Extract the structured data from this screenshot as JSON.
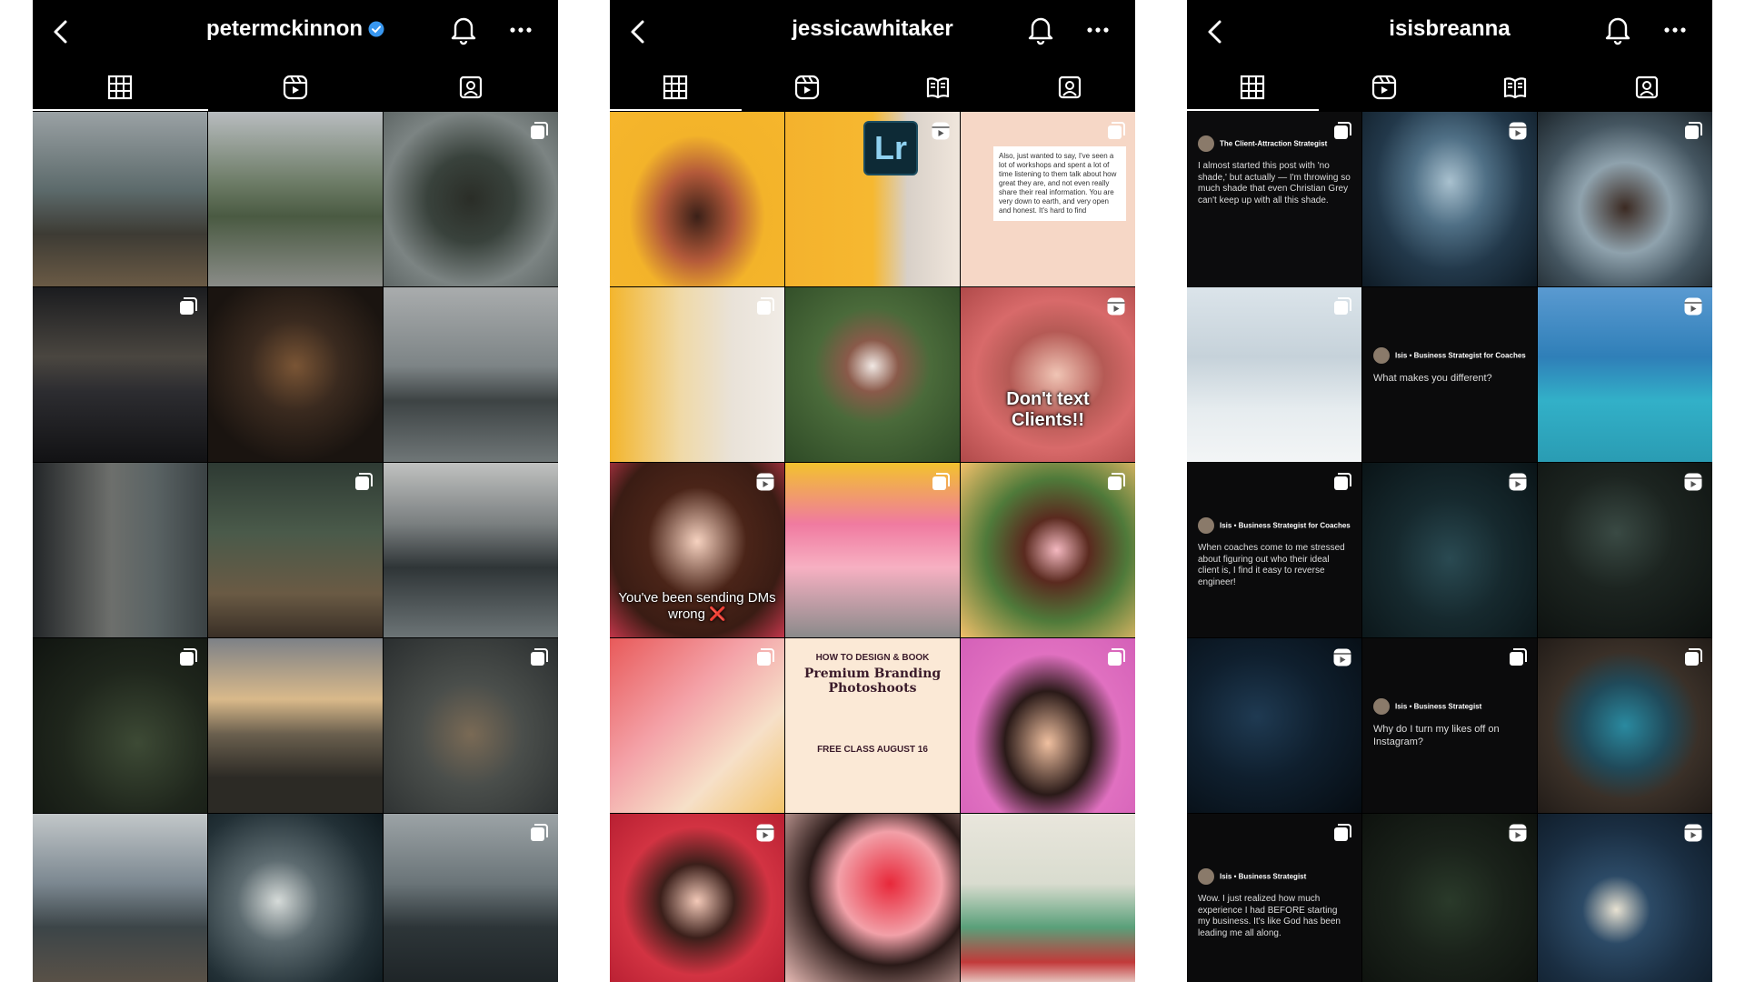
{
  "panels": [
    {
      "username": "petermckinnon",
      "verified": true,
      "tabs": [
        "grid-icon",
        "reels-icon",
        "tagged-icon"
      ],
      "tiles": [
        {
          "bg": "linear-gradient(180deg,#9aa1a4 0%,#5c6a6b 45%,#3d3b34 70%,#6a5a45 100%)"
        },
        {
          "bg": "linear-gradient(180deg,#b8bcbf 0%,#6e7d68 40%,#4a5a42 60%,#8a8c88 100%)"
        },
        {
          "bg": "radial-gradient(circle at 50% 50%,#2a2d27 0%,#39423c 35%,#7c8483 70%,#5f6766 100%)",
          "badge": "carousel-icon"
        },
        {
          "bg": "linear-gradient(180deg,#1b1c1f 0%,#4a4640 40%,#2c2c30 60%,#121214 100%)",
          "badge": "carousel-icon"
        },
        {
          "bg": "radial-gradient(circle at 50% 45%,#7a5535 0%,#3a2a1f 35%,#1a1410 75%)"
        },
        {
          "bg": "linear-gradient(180deg,#a9acad 0%,#7d8486 45%,#3d4344 65%,#6f7677 100%)"
        },
        {
          "bg": "linear-gradient(90deg,#232628 0%,#6d6f6c 45%,#5a6364 70%,#3b4244 100%)"
        },
        {
          "bg": "linear-gradient(180deg,#2e3a33 0%,#4a5a4a 40%,#6a5a44 75%,#3a2f26 100%)",
          "badge": "carousel-icon"
        },
        {
          "bg": "linear-gradient(180deg,#c0c1c0 0%,#7a7f80 35%,#2f3537 60%,#6c7476 100%)"
        },
        {
          "bg": "radial-gradient(circle at 60% 60%,#3d4a35 0%,#1f261c 50%,#101410 100%)",
          "badge": "carousel-icon"
        },
        {
          "bg": "linear-gradient(180deg,#7d8187 0%,#d9b98a 35%,#6a5f4e 55%,#2c2a25 80%)"
        },
        {
          "bg": "radial-gradient(circle at 50% 55%,#7a6a55 0%,#4a4e4b 40%,#2a2e2f 100%)",
          "badge": "carousel-icon"
        },
        {
          "bg": "linear-gradient(180deg,#c2c7c9 0%,#7b8790 40%,#3c4548 65%,#5c5247 100%)"
        },
        {
          "bg": "radial-gradient(circle at 40% 50%,#d6dbd9 0%,#5d6b70 30%,#223036 70%,#0f1a1f 100%)"
        },
        {
          "bg": "linear-gradient(180deg,#9ca3a6 0%,#6a7478 40%,#2d3538 65%,#1d2326 100%)",
          "badge": "carousel-icon"
        }
      ]
    },
    {
      "username": "jessicawhitaker",
      "verified": false,
      "tabs": [
        "grid-icon",
        "reels-icon",
        "guides-icon",
        "tagged-icon"
      ],
      "tiles": [
        {
          "bg": "radial-gradient(ellipse at 50% 60%,#3a2018 0%,#b45a3a 30%,#f3b32a 55%,#f6b62c 100%)"
        },
        {
          "bg": "linear-gradient(90deg,#f4b22d 0%,#f6b830 50%,#d8d0c8 70%,#f0e6dc 100%)",
          "badge": "reels-icon",
          "lr": "Lr"
        },
        {
          "bg": "#f6d7c6",
          "badge": "carousel-icon",
          "note": "Also, just wanted to say, I've seen a lot of workshops and spent a lot of time listening to them talk about how great they are, and not even really share their real information. You are very down to earth, and very open and honest. It's hard to find"
        },
        {
          "bg": "linear-gradient(90deg,#f3b52c 0%,#f0d9a6 40%,#e9e2d8 70%,#f1ece6 100%)",
          "badge": "carousel-icon"
        },
        {
          "bg": "radial-gradient(circle at 50% 45%,#f1e8e4 0%,#8a5a4a 20%,#4a6a3a 45%,#2e4a26 100%)"
        },
        {
          "bg": "radial-gradient(ellipse at 55% 50%,#f0c5b5 0%,#b55a55 35%,#d86a6a 60%,#b04a4a 100%)",
          "badge": "reels-icon",
          "caption": "Don't text Clients!!"
        },
        {
          "bg": "radial-gradient(ellipse at 50% 45%,#f6d2c0 0%,#4a2418 40%,#3a1c14 70%,#c2364a 100%)",
          "badge": "reels-icon",
          "caption": "You've been sending DMs wrong ❌"
        },
        {
          "bg": "linear-gradient(180deg,#f2c22e 0%,#f07aa0 35%,#f7b0c2 60%,#8a8a8a 100%)",
          "badge": "carousel-icon"
        },
        {
          "bg": "radial-gradient(circle at 55% 50%,#f4b8c0 0%,#5a2a1f 25%,#4f7a3a 55%,#f2c06a 100%)",
          "badge": "carousel-icon"
        },
        {
          "bg": "linear-gradient(135deg,#e85a5a 0%,#f4a2a8 40%,#f6e0c8 70%,#f2c36a 100%)",
          "badge": "carousel-icon"
        },
        {
          "bg": "#fbe9d6",
          "promo": true
        },
        {
          "bg": "radial-gradient(ellipse at 50% 60%,#f0c0a0 0%,#2a1a18 35%,#e070c0 60%,#d460b8 100%)",
          "badge": "carousel-icon"
        },
        {
          "bg": "radial-gradient(ellipse at 50% 50%,#f3c9b8 0%,#3b1f1a 30%,#d23342 60%,#b81f32 100%)",
          "badge": "reels-icon"
        },
        {
          "bg": "radial-gradient(circle at 60% 40%,#e8283a 0%,#f2a0a8 35%,#2a1a18 55%,#f5c6c0 100%)"
        },
        {
          "bg": "linear-gradient(180deg,#e9e6dc 0%,#d9dccf 40%,#5aa07a 65%,#c23a3a 85%,#f1ede6 100%)"
        }
      ],
      "promo": {
        "line1": "HOW TO DESIGN & BOOK",
        "line2": "Premium Branding Photoshoots",
        "line3": "FREE CLASS AUGUST 16"
      }
    },
    {
      "username": "isisbreanna",
      "verified": false,
      "tabs": [
        "grid-icon",
        "reels-icon",
        "guides-icon",
        "tagged-icon"
      ],
      "tiles": [
        {
          "bg": "#0c0c0d",
          "badge": "carousel-icon",
          "tweet": {
            "name": "The Client-Attraction Strategist",
            "text": "I almost started this post with 'no shade,' but actually — I'm throwing so much shade that even Christian Grey can't keep up with all this shade."
          }
        },
        {
          "bg": "radial-gradient(ellipse at 50% 40%,#a9c1cf 0%,#4f6f85 30%,#22384a 60%,#0e1a24 100%)",
          "badge": "reels-icon"
        },
        {
          "bg": "radial-gradient(circle at 50% 55%,#3b2a22 0%,#8fa2ad 35%,#445560 65%,#1d262c 100%)",
          "badge": "carousel-icon"
        },
        {
          "bg": "linear-gradient(180deg,#dbe4ea 0%,#c6d2da 40%,#e6ecef 70%,#f3f5f6 100%)",
          "badge": "carousel-icon"
        },
        {
          "bg": "#0b0b0c",
          "tweet": {
            "name": "Isis • Business Strategist for Coaches",
            "text": "What makes you different?"
          }
        },
        {
          "bg": "linear-gradient(180deg,#5a9ad1 0%,#2f7fb8 40%,#32b0c8 65%,#2a9cb3 100%)",
          "badge": "reels-icon"
        },
        {
          "bg": "#0b0b0c",
          "badge": "carousel-icon",
          "tweet": {
            "name": "Isis • Business Strategist for Coaches",
            "text": "When coaches come to me stressed about figuring out who their ideal client is, I find it easy to reverse engineer!"
          }
        },
        {
          "bg": "radial-gradient(ellipse at 50% 55%,#2a4a52 0%,#16292e 45%,#0a1417 100%)",
          "badge": "reels-icon"
        },
        {
          "bg": "radial-gradient(circle at 45% 40%,#3a4a44 0%,#1c2420 40%,#0c100e 100%)",
          "badge": "reels-icon"
        },
        {
          "bg": "radial-gradient(ellipse at 40% 45%,#1f3a52 0%,#0f1f2e 45%,#060c12 100%)",
          "badge": "reels-icon"
        },
        {
          "bg": "#0b0b0c",
          "badge": "carousel-icon",
          "tweet": {
            "name": "Isis • Business Strategist",
            "text": "Why do I turn my likes off on Instagram?"
          }
        },
        {
          "bg": "radial-gradient(ellipse at 50% 50%,#2a8aa0 0%,#204a5a 35%,#3a3028 60%,#221c18 100%)",
          "badge": "carousel-icon"
        },
        {
          "bg": "#0b0b0c",
          "badge": "carousel-icon",
          "tweet": {
            "name": "Isis • Business Strategist",
            "text": "Wow. I just realized how much experience I had BEFORE starting my business. It's like God has been leading me all along."
          }
        },
        {
          "bg": "radial-gradient(circle at 50% 50%,#2a3a2a 0%,#1a221a 45%,#0e120e 100%)",
          "badge": "reels-icon"
        },
        {
          "bg": "radial-gradient(ellipse at 45% 55%,#e8e2d2 0%,#2c4a66 25%,#1a2e42 60%,#0e1a26 100%)",
          "badge": "reels-icon"
        }
      ]
    }
  ]
}
